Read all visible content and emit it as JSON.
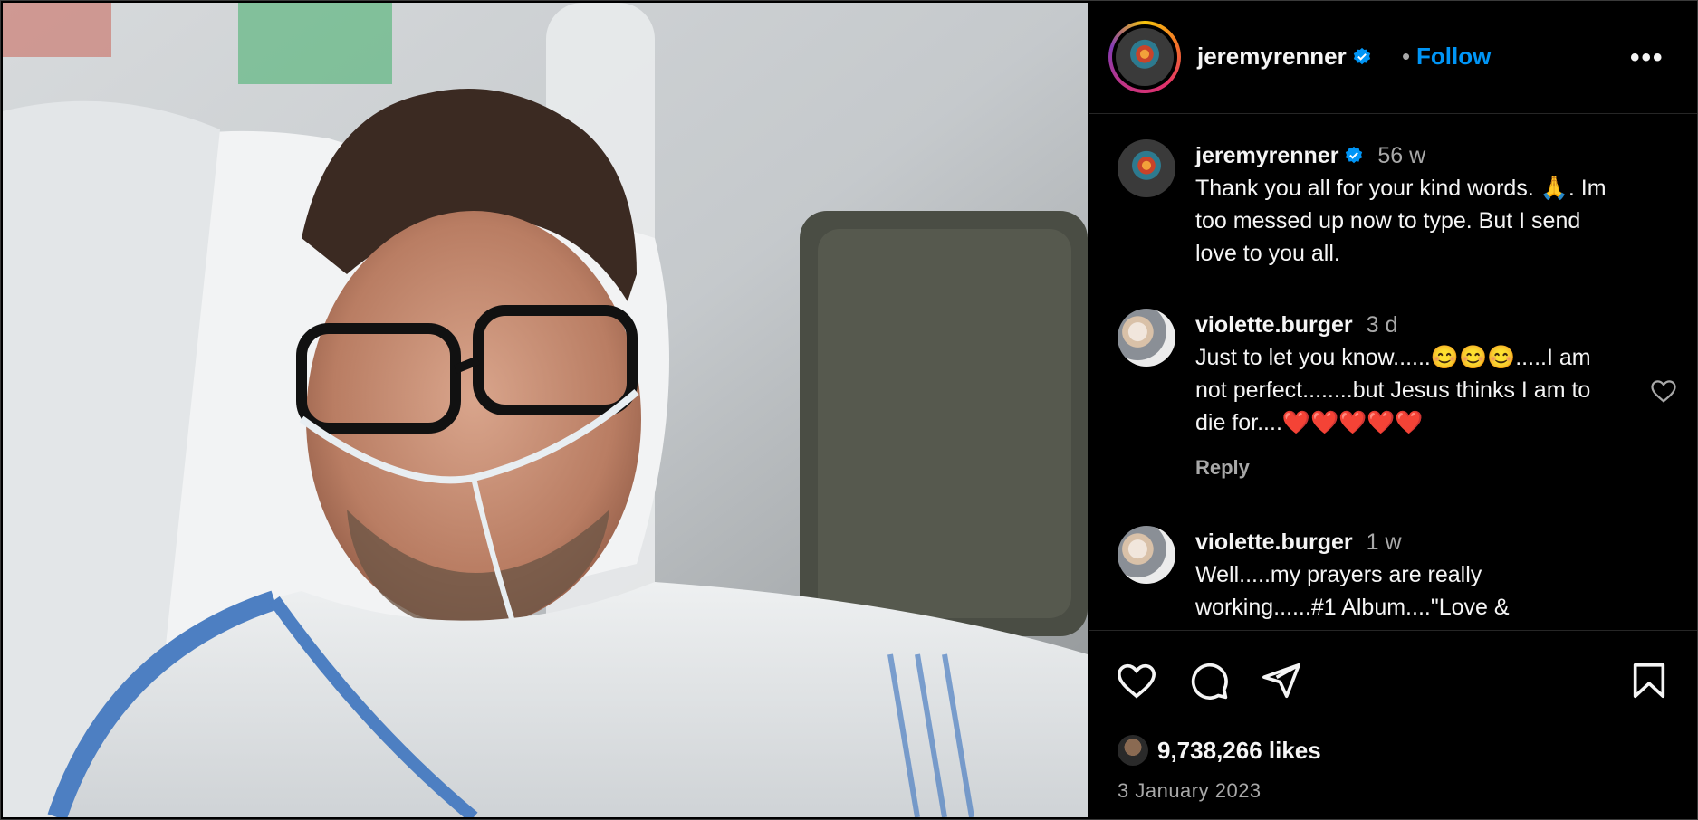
{
  "header": {
    "username": "jeremyrenner",
    "separator": "•",
    "follow_label": "Follow",
    "more_label": "•••"
  },
  "caption": {
    "username": "jeremyrenner",
    "time": "56 w",
    "text": "Thank you all for your kind words. 🙏. Im too messed up now to type. But I send love to you all."
  },
  "comments": [
    {
      "username": "violette.burger",
      "time": "3 d",
      "text": "Just to let you know......😊😊😊.....I am not perfect........but Jesus thinks I am to die for....❤️❤️❤️❤️❤️",
      "reply_label": "Reply"
    },
    {
      "username": "violette.burger",
      "time": "1 w",
      "text": "Well.....my prayers are really working......#1 Album....\"Love &"
    }
  ],
  "post": {
    "likes": "9,738,266 likes",
    "date": "3 January 2023"
  },
  "colors": {
    "accent": "#0095f6",
    "verified": "#0095f6",
    "secondary_text": "#a8a8a8",
    "heart_red": "#ff3040"
  },
  "icons": {
    "like": "heart-icon",
    "comment": "comment-bubble-icon",
    "share": "paper-plane-icon",
    "save": "bookmark-icon",
    "verified": "verified-badge-icon",
    "more": "more-options-icon"
  }
}
